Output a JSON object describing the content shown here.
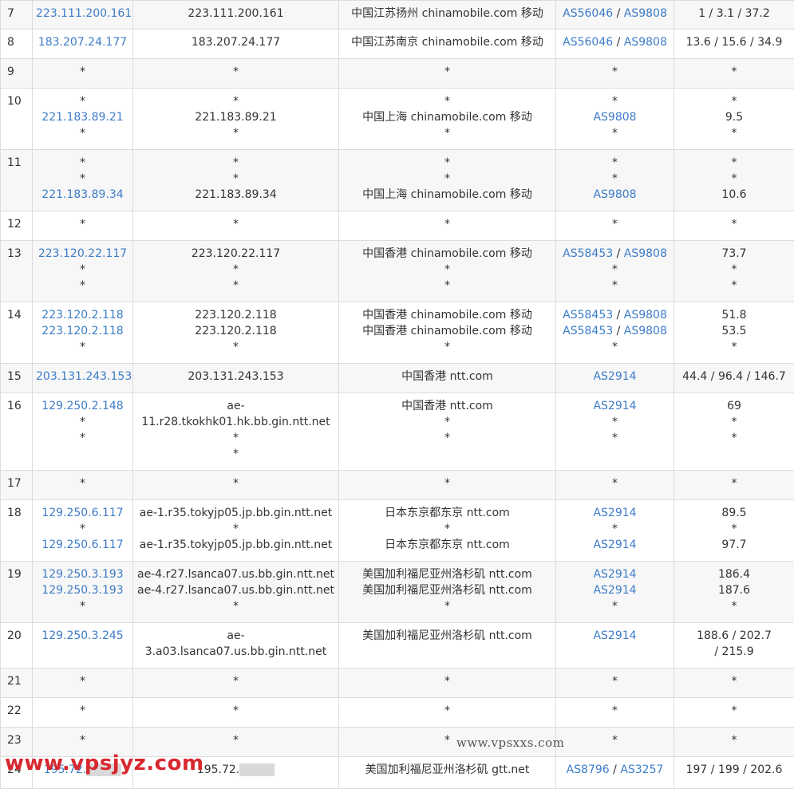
{
  "colors": {
    "link": "#3d7cc9",
    "watermark_red": "#d8282f",
    "row_alt": "#f7f7f7",
    "border": "#dcdcdc"
  },
  "rows": [
    {
      "hop": "7",
      "ips": [
        "223.111.200.161"
      ],
      "hosts": [
        "223.111.200.161"
      ],
      "locations": [
        "中国江苏扬州 chinamobile.com 移动"
      ],
      "asns": [
        [
          "AS56046",
          "AS9808"
        ]
      ],
      "times": [
        "1 / 3.1 / 37.2"
      ]
    },
    {
      "hop": "8",
      "ips": [
        "183.207.24.177"
      ],
      "hosts": [
        "183.207.24.177"
      ],
      "locations": [
        "中国江苏南京 chinamobile.com 移动"
      ],
      "asns": [
        [
          "AS56046",
          "AS9808"
        ]
      ],
      "times": [
        "13.6 / 15.6 / 34.9"
      ]
    },
    {
      "hop": "9",
      "ips": [
        "*"
      ],
      "hosts": [
        "*"
      ],
      "locations": [
        "*"
      ],
      "asns": [
        [
          "*"
        ]
      ],
      "times": [
        "*"
      ]
    },
    {
      "hop": "10",
      "ips": [
        "*",
        "221.183.89.21",
        "*"
      ],
      "hosts": [
        "*",
        "221.183.89.21",
        "*"
      ],
      "locations": [
        "*",
        "中国上海 chinamobile.com 移动",
        "*"
      ],
      "asns": [
        [
          "*"
        ],
        [
          "AS9808"
        ],
        [
          "*"
        ]
      ],
      "times": [
        "*",
        "9.5",
        "*"
      ]
    },
    {
      "hop": "11",
      "ips": [
        "*",
        "*",
        "221.183.89.34"
      ],
      "hosts": [
        "*",
        "*",
        "221.183.89.34"
      ],
      "locations": [
        "*",
        "*",
        "中国上海 chinamobile.com 移动"
      ],
      "asns": [
        [
          "*"
        ],
        [
          "*"
        ],
        [
          "AS9808"
        ]
      ],
      "times": [
        "*",
        "*",
        "10.6"
      ]
    },
    {
      "hop": "12",
      "ips": [
        "*"
      ],
      "hosts": [
        "*"
      ],
      "locations": [
        "*"
      ],
      "asns": [
        [
          "*"
        ]
      ],
      "times": [
        "*"
      ]
    },
    {
      "hop": "13",
      "ips": [
        "223.120.22.117",
        "*",
        "*"
      ],
      "hosts": [
        "223.120.22.117",
        "*",
        "*"
      ],
      "locations": [
        "中国香港 chinamobile.com 移动",
        "*",
        "*"
      ],
      "asns": [
        [
          "AS58453",
          "AS9808"
        ],
        [
          "*"
        ],
        [
          "*"
        ]
      ],
      "times": [
        "73.7",
        "*",
        "*"
      ]
    },
    {
      "hop": "14",
      "ips": [
        "223.120.2.118",
        "223.120.2.118",
        "*"
      ],
      "hosts": [
        "223.120.2.118",
        "223.120.2.118",
        "*"
      ],
      "locations": [
        "中国香港 chinamobile.com 移动",
        "中国香港 chinamobile.com 移动",
        "*"
      ],
      "asns": [
        [
          "AS58453",
          "AS9808"
        ],
        [
          "AS58453",
          "AS9808"
        ],
        [
          "*"
        ]
      ],
      "times": [
        "51.8",
        "53.5",
        "*"
      ]
    },
    {
      "hop": "15",
      "ips": [
        "203.131.243.153"
      ],
      "hosts": [
        "203.131.243.153"
      ],
      "locations": [
        "中国香港 ntt.com"
      ],
      "asns": [
        [
          "AS2914"
        ]
      ],
      "times": [
        "44.4 / 96.4 / 146.7"
      ]
    },
    {
      "hop": "16",
      "ips": [
        "129.250.2.148",
        "*",
        "*"
      ],
      "hosts": [
        "ae-11.r28.tkokhk01.hk.bb.gin.ntt.net",
        "*",
        "*"
      ],
      "locations": [
        "中国香港 ntt.com",
        "*",
        "*"
      ],
      "asns": [
        [
          "AS2914"
        ],
        [
          "*"
        ],
        [
          "*"
        ]
      ],
      "times": [
        "69",
        "*",
        "*"
      ]
    },
    {
      "hop": "17",
      "ips": [
        "*"
      ],
      "hosts": [
        "*"
      ],
      "locations": [
        "*"
      ],
      "asns": [
        [
          "*"
        ]
      ],
      "times": [
        "*"
      ]
    },
    {
      "hop": "18",
      "ips": [
        "129.250.6.117",
        "*",
        "129.250.6.117"
      ],
      "hosts": [
        "ae-1.r35.tokyjp05.jp.bb.gin.ntt.net",
        "*",
        "ae-1.r35.tokyjp05.jp.bb.gin.ntt.net"
      ],
      "locations": [
        "日本东京都东京 ntt.com",
        "*",
        "日本东京都东京 ntt.com"
      ],
      "asns": [
        [
          "AS2914"
        ],
        [
          "*"
        ],
        [
          "AS2914"
        ]
      ],
      "times": [
        "89.5",
        "*",
        "97.7"
      ]
    },
    {
      "hop": "19",
      "ips": [
        "129.250.3.193",
        "129.250.3.193",
        "*"
      ],
      "hosts": [
        "ae-4.r27.lsanca07.us.bb.gin.ntt.net",
        "ae-4.r27.lsanca07.us.bb.gin.ntt.net",
        "*"
      ],
      "locations": [
        "美国加利福尼亚州洛杉矶 ntt.com",
        "美国加利福尼亚州洛杉矶 ntt.com",
        "*"
      ],
      "asns": [
        [
          "AS2914"
        ],
        [
          "AS2914"
        ],
        [
          "*"
        ]
      ],
      "times": [
        "186.4",
        "187.6",
        "*"
      ]
    },
    {
      "hop": "20",
      "ips": [
        "129.250.3.245"
      ],
      "hosts": [
        "ae-3.a03.lsanca07.us.bb.gin.ntt.net"
      ],
      "locations": [
        "美国加利福尼亚州洛杉矶 ntt.com"
      ],
      "asns": [
        [
          "AS2914"
        ]
      ],
      "times": [
        "188.6 / 202.7 / 215.9"
      ]
    },
    {
      "hop": "21",
      "ips": [
        "*"
      ],
      "hosts": [
        "*"
      ],
      "locations": [
        "*"
      ],
      "asns": [
        [
          "*"
        ]
      ],
      "times": [
        "*"
      ]
    },
    {
      "hop": "22",
      "ips": [
        "*"
      ],
      "hosts": [
        "*"
      ],
      "locations": [
        "*"
      ],
      "asns": [
        [
          "*"
        ]
      ],
      "times": [
        "*"
      ]
    },
    {
      "hop": "23",
      "ips": [
        "*"
      ],
      "hosts": [
        "*"
      ],
      "locations": [
        "*"
      ],
      "asns": [
        [
          "*"
        ]
      ],
      "times": [
        "*"
      ]
    },
    {
      "hop": "24",
      "ips": [
        "195.72."
      ],
      "hosts": [
        "195.72."
      ],
      "locations": [
        "美国加利福尼亚州洛杉矶 gtt.net"
      ],
      "asns": [
        [
          "AS8796",
          "AS3257"
        ]
      ],
      "times": [
        "197 / 199 / 202.6"
      ]
    }
  ],
  "watermarks": {
    "left": "www.vpsjyz.com",
    "center": "www.vpsxxs.com"
  }
}
